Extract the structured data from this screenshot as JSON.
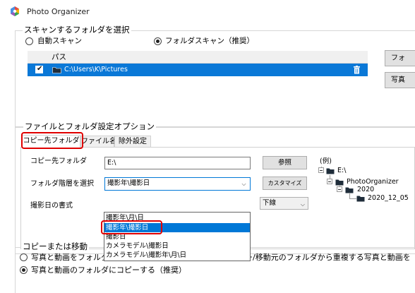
{
  "window": {
    "title": "Photo Organizer"
  },
  "scan": {
    "legend": "スキャンするフォルダを選択",
    "radio_auto": "自動スキャン",
    "radio_folder": "フォルダスキャン（推奨）",
    "list_header": "パス",
    "rows": [
      {
        "checked": "✔",
        "path": "C:\\Users\\K\\Pictures"
      }
    ],
    "side_buttons": [
      "フォ",
      "写真"
    ]
  },
  "options": {
    "legend": "ファイルとフォルダ設定オプション",
    "tabs": [
      "コピー先フォルダ",
      "ファイル名",
      "除外設定"
    ],
    "copy_dest_label": "コピー先フォルダ",
    "copy_dest_value": "E:\\",
    "browse_button": "参照",
    "hierarchy_label": "フォルダ階層を選択",
    "hierarchy_value": "撮影年\\撮影日",
    "customize_button": "カスタマイズ",
    "date_format_label": "撮影日の書式",
    "date_format_value": "下線",
    "dropdown_options": [
      "撮影年\\月\\日",
      "撮影年\\撮影日",
      "撮影日",
      "カメラモデル\\撮影日",
      "カメラモデル\\撮影年\\月\\日"
    ],
    "example_label": "(例)",
    "tree": [
      "E:\\",
      "PhotoOrganizer",
      "2020",
      "2020_12_05"
    ]
  },
  "copymove": {
    "legend": "コピーまたは移動",
    "move_label": "写真と動画をフォルダに移動",
    "copy_label": "写真と動画のフォルダにコピーする（推奨）",
    "dedupe_label": "コピー/移動元のフォルダから重複する写真と動画を"
  },
  "colors": {
    "selection": "#0078d7",
    "highlight_box": "#e00000"
  }
}
